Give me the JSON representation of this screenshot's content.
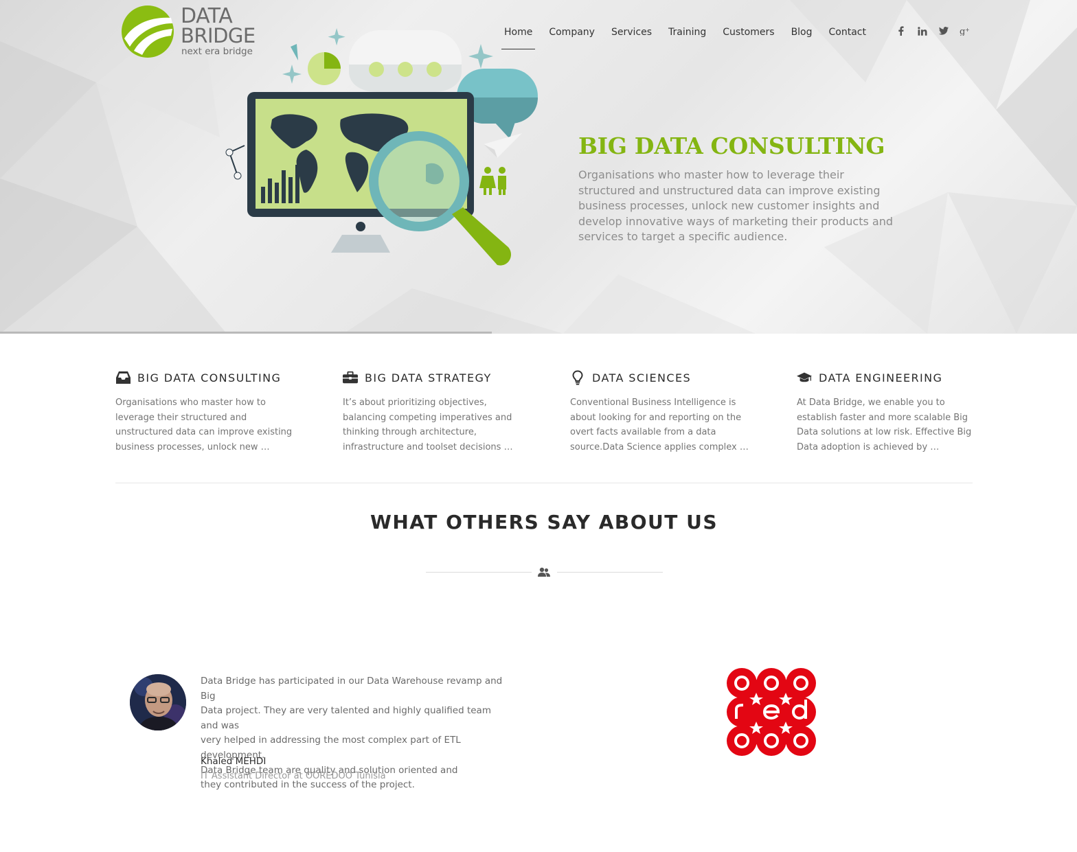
{
  "brand": {
    "logo_line1": "DATA",
    "logo_line2": "BRIDGE",
    "tagline": "next era bridge",
    "accent_color": "#84b512"
  },
  "nav": {
    "items": [
      {
        "label": "Home",
        "active": true
      },
      {
        "label": "Company"
      },
      {
        "label": "Services"
      },
      {
        "label": "Training"
      },
      {
        "label": "Customers"
      },
      {
        "label": "Blog"
      },
      {
        "label": "Contact"
      }
    ],
    "social": [
      {
        "icon": "facebook-icon"
      },
      {
        "icon": "linkedin-icon"
      },
      {
        "icon": "twitter-icon"
      },
      {
        "icon": "google-plus-icon"
      }
    ]
  },
  "hero": {
    "title": "BIG DATA CONSULTING",
    "text": "Organisations who master how to leverage their structured and unstructured data can improve existing business processes, unlock new customer insights and develop innovative ways of marketing their products and services to target a specific audience."
  },
  "services": [
    {
      "icon": "inbox-icon",
      "title": "BIG DATA CONSULTING",
      "text": "Organisations who master how to leverage their structured and unstructured data can improve existing business processes, unlock new …"
    },
    {
      "icon": "briefcase-icon",
      "title": "BIG DATA STRATEGY",
      "text": "It’s about prioritizing objectives, balancing competing imperatives and thinking through architecture, infrastructure and toolset decisions …"
    },
    {
      "icon": "lightbulb-icon",
      "title": "DATA SCIENCES",
      "text": "Conventional Business Intelligence is about looking for and reporting on the overt facts available from a data source.Data Science applies complex …"
    },
    {
      "icon": "graduation-cap-icon",
      "title": "DATA ENGINEERING",
      "text": "At Data Bridge, we enable you to establish faster and more scalable Big Data solutions at low risk. Effective Big Data adoption is achieved by …"
    }
  ],
  "testimonials": {
    "title": "WHAT OTHERS SAY ABOUT US",
    "separator_icon": "users-icon",
    "items": [
      {
        "lines": [
          "Data Bridge has participated in our Data Warehouse revamp and Big",
          "Data project. They are very talented and highly qualified team and was",
          "very helped in addressing the most complex part of ETL development.",
          "Data Bridge team are quality and solution oriented and",
          "they contributed in the success of the project."
        ],
        "author": "Khaled MEHDI",
        "role": "IT Assistant Director at OOREDOO Tunisia",
        "brand_logo": "ooredoo",
        "brand_color": "#e30613"
      }
    ]
  }
}
